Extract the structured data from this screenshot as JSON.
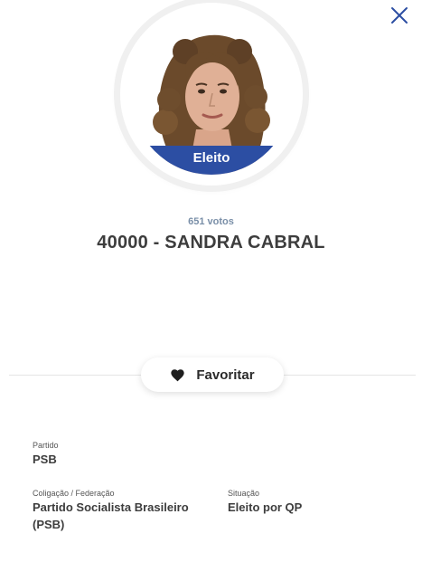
{
  "close": {
    "icon": "close-icon"
  },
  "candidate": {
    "status_badge": "Eleito",
    "votes": "651 votos",
    "name": "40000 - SANDRA CABRAL",
    "photo": "candidate-photo"
  },
  "actions": {
    "favorite_label": "Favoritar",
    "favorite_icon": "heart-icon"
  },
  "details": {
    "party_label": "Partido",
    "party_value": "PSB",
    "coalition_label": "Coligação / Federação",
    "coalition_value": "Partido Socialista Brasileiro (PSB)",
    "situation_label": "Situação",
    "situation_value": "Eleito por QP"
  },
  "colors": {
    "accent": "#2c4ea3",
    "close_icon": "#2c4ea3",
    "votes_text": "#7a8fa8",
    "name_text": "#3d3d3d"
  }
}
